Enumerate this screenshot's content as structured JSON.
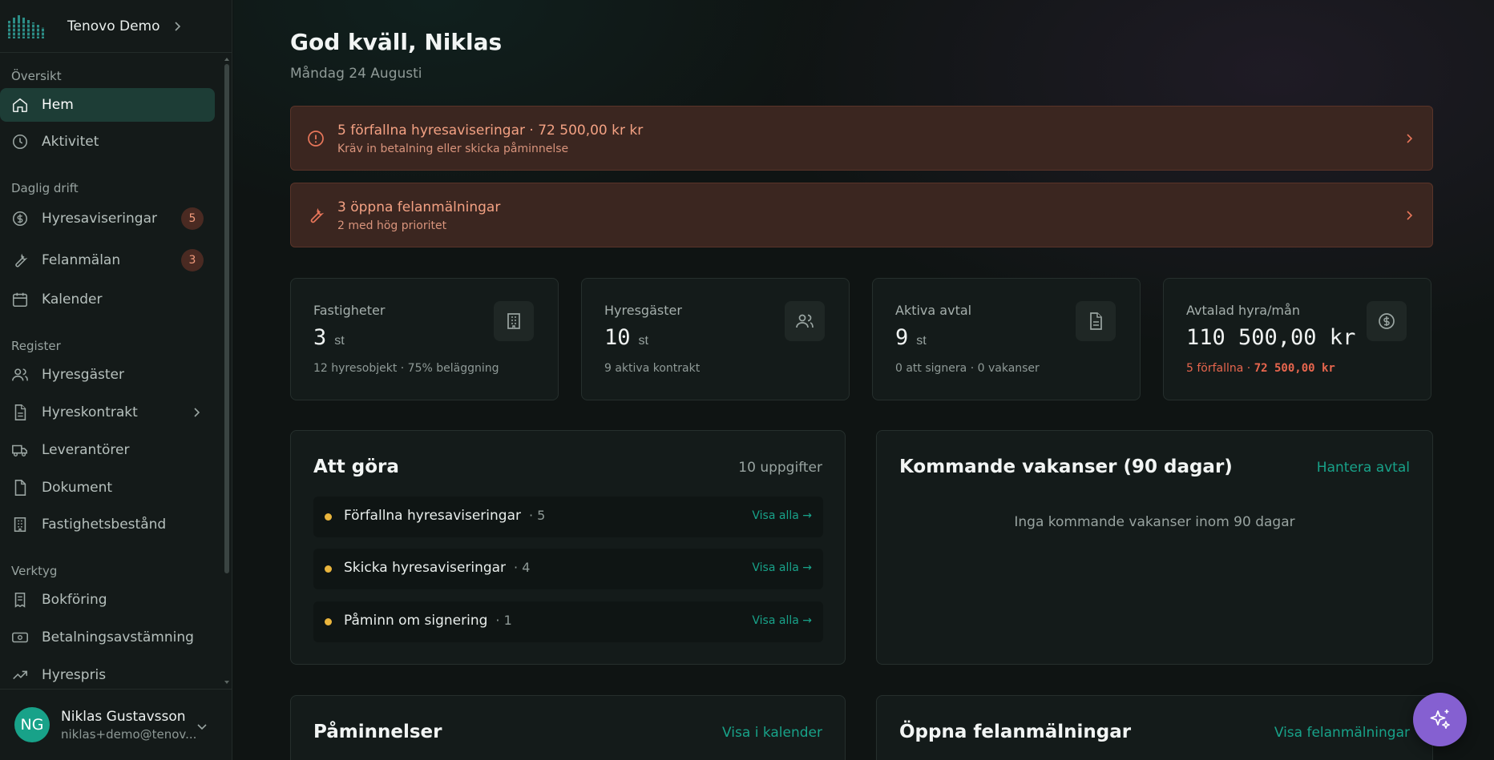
{
  "sidebar": {
    "org_name": "Tenovo Demo",
    "sections": {
      "overview": "Översikt",
      "daily": "Daglig drift",
      "register": "Register",
      "tools": "Verktyg"
    },
    "items": {
      "home": "Hem",
      "activity": "Aktivitet",
      "rent_notices": "Hyresaviseringar",
      "rent_notices_count": "5",
      "fault_reports": "Felanmälan",
      "fault_reports_count": "3",
      "calendar": "Kalender",
      "tenants": "Hyresgäster",
      "leases": "Hyreskontrakt",
      "suppliers": "Leverantörer",
      "documents": "Dokument",
      "properties": "Fastighetsbestånd",
      "bookkeeping": "Bokföring",
      "payment_reconciliation": "Betalningsavstämning",
      "rent_price": "Hyrespris"
    },
    "user": {
      "initials": "NG",
      "name": "Niklas Gustavsson",
      "email": "niklas+demo@tenov..."
    }
  },
  "header": {
    "greeting": "God kväll, Niklas",
    "date": "Måndag 24 Augusti"
  },
  "alerts": [
    {
      "title": "5 förfallna hyresaviseringar · 72 500,00 kr kr",
      "subtitle": "Kräv in betalning eller skicka påminnelse"
    },
    {
      "title": "3 öppna felanmälningar",
      "subtitle": "2 med hög prioritet"
    }
  ],
  "stats": [
    {
      "label": "Fastigheter",
      "value": "3",
      "unit": "st",
      "note": "12 hyresobjekt · 75% beläggning"
    },
    {
      "label": "Hyresgäster",
      "value": "10",
      "unit": "st",
      "note": "9 aktiva kontrakt"
    },
    {
      "label": "Aktiva avtal",
      "value": "9",
      "unit": "st",
      "note": "0 att signera · 0 vakanser"
    },
    {
      "label": "Avtalad hyra/mån",
      "value": "110 500,00 kr",
      "note_prefix": "5 förfallna · ",
      "note_amount": "72 500,00 kr"
    }
  ],
  "todo": {
    "title": "Att göra",
    "meta": "10 uppgifter",
    "rows": [
      {
        "label": "Förfallna hyresaviseringar",
        "count": "· 5",
        "link": "Visa alla →"
      },
      {
        "label": "Skicka hyresaviseringar",
        "count": "· 4",
        "link": "Visa alla →"
      },
      {
        "label": "Påminn om signering",
        "count": "· 1",
        "link": "Visa alla →"
      }
    ]
  },
  "vacancies": {
    "title": "Kommande vakanser (90 dagar)",
    "action": "Hantera avtal",
    "empty": "Inga kommande vakanser inom 90 dagar"
  },
  "reminders": {
    "title": "Påminnelser",
    "action": "Visa i kalender"
  },
  "open_faults": {
    "title": "Öppna felanmälningar",
    "action": "Visa felanmälningar"
  },
  "colors": {
    "accent": "#18a289",
    "warning_bg": "#3b2620",
    "warning_text": "#f3a183",
    "fab": "#8560d1"
  }
}
